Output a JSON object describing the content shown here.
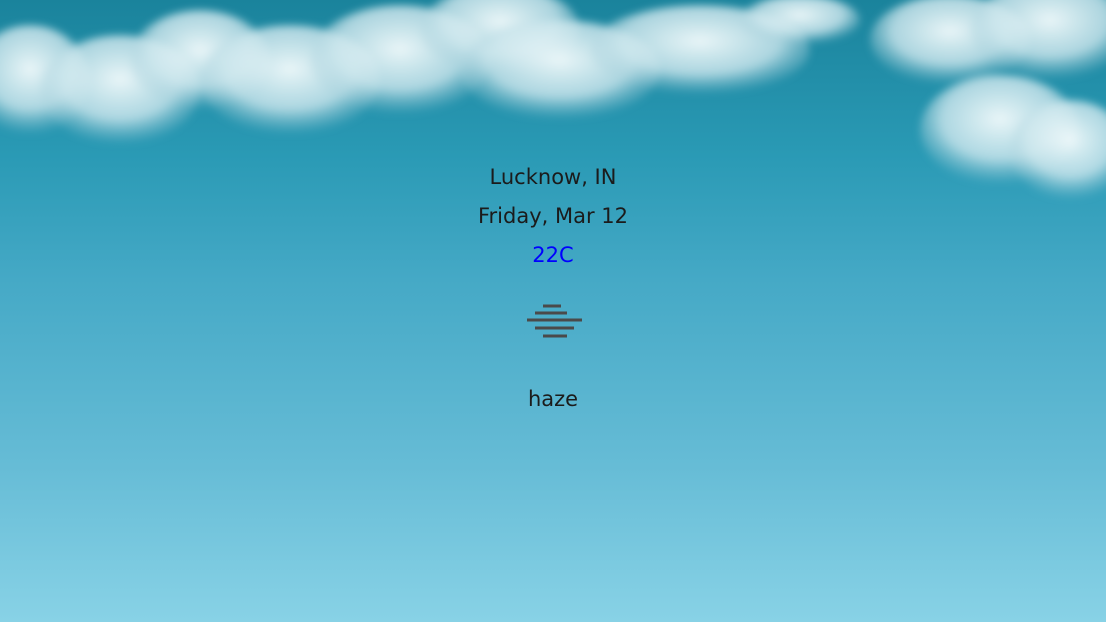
{
  "weather": {
    "location": "Lucknow, IN",
    "date": "Friday, Mar 12",
    "temperature": "22C",
    "condition": "haze",
    "icon": "haze-icon"
  },
  "colors": {
    "temperature_text": "#0000ff",
    "body_text": "#1b1b1b",
    "icon_stroke": "#4a4a4a",
    "sky_top": "#1a839c",
    "sky_bottom": "#88d2e6"
  }
}
